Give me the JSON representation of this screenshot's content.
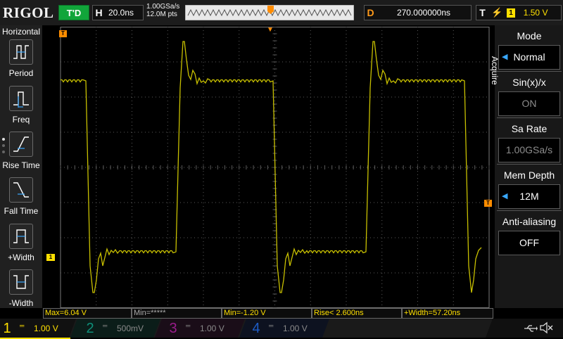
{
  "brand": {
    "name": "RIGOL"
  },
  "top": {
    "run_state": "T'D",
    "horizontal": {
      "label": "H",
      "value": "20.0ns"
    },
    "sample_rate": "1.00GSa/s",
    "memory_points": "12.0M pts",
    "delay": {
      "label": "D",
      "value": "270.000000ns"
    },
    "trigger": {
      "label": "T",
      "edge_symbol": "⚡",
      "source": "1",
      "level": "1.50 V"
    }
  },
  "left_menu": {
    "title": "Horizontal",
    "items": [
      {
        "label": "Period",
        "icon": "period-icon"
      },
      {
        "label": "Freq",
        "icon": "freq-icon"
      },
      {
        "label": "Rise Time",
        "icon": "rise-time-icon"
      },
      {
        "label": "Fall Time",
        "icon": "fall-time-icon"
      },
      {
        "label": "+Width",
        "icon": "positive-width-icon"
      },
      {
        "label": "-Width",
        "icon": "negative-width-icon"
      }
    ]
  },
  "right_menu": {
    "title": "Acquire",
    "items": [
      {
        "title": "Mode",
        "value": "Normal",
        "has_arrow": true,
        "enabled": true
      },
      {
        "title": "Sin(x)/x",
        "value": "ON",
        "has_arrow": false,
        "enabled": false
      },
      {
        "title": "Sa Rate",
        "value": "1.00GSa/s",
        "has_arrow": false,
        "enabled": false
      },
      {
        "title": "Mem Depth",
        "value": "12M",
        "has_arrow": true,
        "enabled": true
      },
      {
        "title": "Anti-aliasing",
        "value": "OFF",
        "has_arrow": false,
        "enabled": true
      }
    ]
  },
  "markers": {
    "trigger_position": "T",
    "channel1": "1",
    "trigger_level": "T"
  },
  "measurements": [
    {
      "text": "Max=6.04 V",
      "active": true
    },
    {
      "text": "Min=*****",
      "active": false
    },
    {
      "text": "Min=-1.20 V",
      "active": true
    },
    {
      "text": "Rise< 2.600ns",
      "active": true
    },
    {
      "text": "+Width=57.20ns",
      "active": true
    }
  ],
  "channels": [
    {
      "number": "1",
      "coupling": "═",
      "scale": "1.00 V"
    },
    {
      "number": "2",
      "coupling": "═",
      "scale": "500mV"
    },
    {
      "number": "3",
      "coupling": "═",
      "scale": "1.00 V"
    },
    {
      "number": "4",
      "coupling": "═",
      "scale": "1.00 V"
    }
  ],
  "colors": {
    "channel1": "#ffe000",
    "channel2": "#0e8f7a",
    "channel3": "#9a1c8c",
    "channel4": "#1d5cc5",
    "trigger": "#ff8c00",
    "waveform": "#c8c000",
    "run_state_bg": "#11a53a",
    "grid": "#5a5a5a"
  },
  "status_icons": [
    "usb-icon",
    "speaker-muted-icon"
  ]
}
